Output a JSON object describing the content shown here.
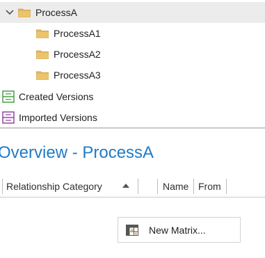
{
  "tree": {
    "root": {
      "label": "ProcessA",
      "expanded": true,
      "selected": true
    },
    "children": [
      {
        "label": "ProcessA1"
      },
      {
        "label": "ProcessA2"
      },
      {
        "label": "ProcessA3"
      }
    ],
    "versions": [
      {
        "label": "Created Versions",
        "icon": "created-versions-icon",
        "color": "#3a9a3a"
      },
      {
        "label": "Imported Versions",
        "icon": "imported-versions-icon",
        "color": "#8b3a9a"
      }
    ],
    "folder_color": "#e2b85f"
  },
  "overview": {
    "title": "Overview - ProcessA",
    "title_color": "#1f7bc8",
    "columns": [
      {
        "label": "Relationship Category",
        "sorted": "ascending"
      },
      {
        "label": "Name"
      },
      {
        "label": "From"
      }
    ],
    "new_matrix_label": "New Matrix..."
  }
}
